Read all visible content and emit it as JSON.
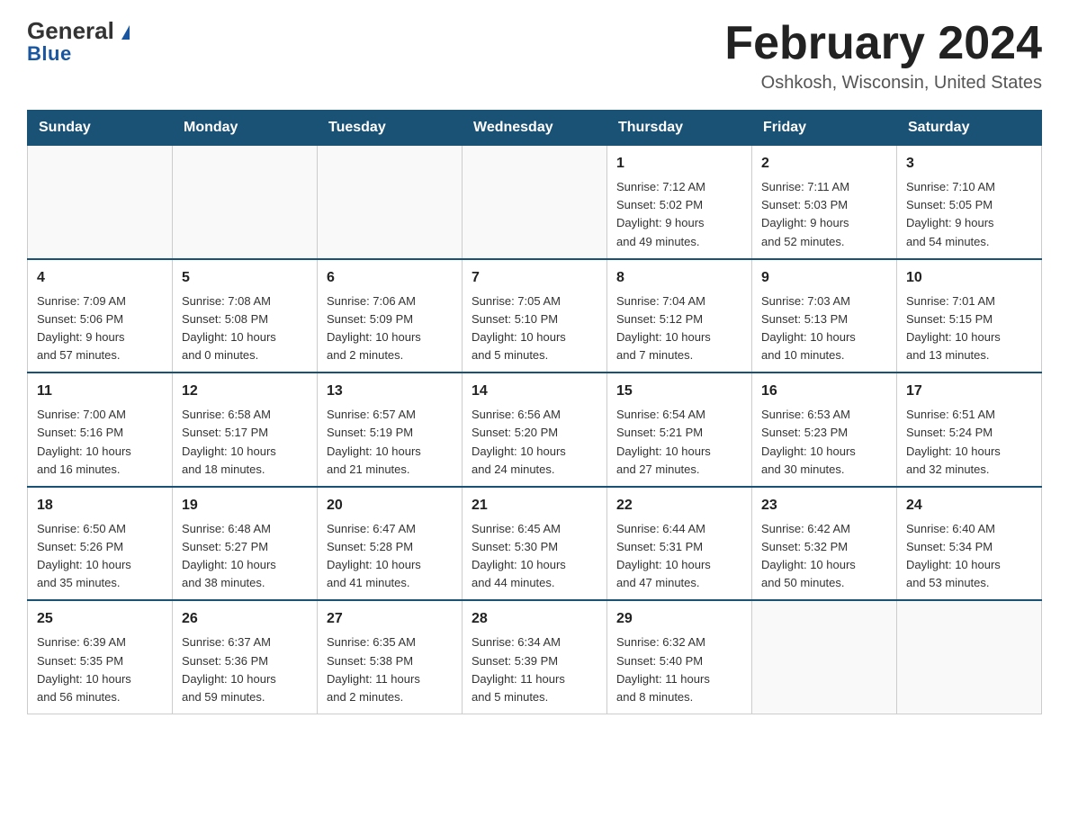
{
  "logo": {
    "top": "General",
    "triangle_text": "▶",
    "bottom": "Blue"
  },
  "calendar": {
    "title": "February 2024",
    "subtitle": "Oshkosh, Wisconsin, United States",
    "headers": [
      "Sunday",
      "Monday",
      "Tuesday",
      "Wednesday",
      "Thursday",
      "Friday",
      "Saturday"
    ],
    "weeks": [
      [
        {
          "day": "",
          "info": ""
        },
        {
          "day": "",
          "info": ""
        },
        {
          "day": "",
          "info": ""
        },
        {
          "day": "",
          "info": ""
        },
        {
          "day": "1",
          "info": "Sunrise: 7:12 AM\nSunset: 5:02 PM\nDaylight: 9 hours\nand 49 minutes."
        },
        {
          "day": "2",
          "info": "Sunrise: 7:11 AM\nSunset: 5:03 PM\nDaylight: 9 hours\nand 52 minutes."
        },
        {
          "day": "3",
          "info": "Sunrise: 7:10 AM\nSunset: 5:05 PM\nDaylight: 9 hours\nand 54 minutes."
        }
      ],
      [
        {
          "day": "4",
          "info": "Sunrise: 7:09 AM\nSunset: 5:06 PM\nDaylight: 9 hours\nand 57 minutes."
        },
        {
          "day": "5",
          "info": "Sunrise: 7:08 AM\nSunset: 5:08 PM\nDaylight: 10 hours\nand 0 minutes."
        },
        {
          "day": "6",
          "info": "Sunrise: 7:06 AM\nSunset: 5:09 PM\nDaylight: 10 hours\nand 2 minutes."
        },
        {
          "day": "7",
          "info": "Sunrise: 7:05 AM\nSunset: 5:10 PM\nDaylight: 10 hours\nand 5 minutes."
        },
        {
          "day": "8",
          "info": "Sunrise: 7:04 AM\nSunset: 5:12 PM\nDaylight: 10 hours\nand 7 minutes."
        },
        {
          "day": "9",
          "info": "Sunrise: 7:03 AM\nSunset: 5:13 PM\nDaylight: 10 hours\nand 10 minutes."
        },
        {
          "day": "10",
          "info": "Sunrise: 7:01 AM\nSunset: 5:15 PM\nDaylight: 10 hours\nand 13 minutes."
        }
      ],
      [
        {
          "day": "11",
          "info": "Sunrise: 7:00 AM\nSunset: 5:16 PM\nDaylight: 10 hours\nand 16 minutes."
        },
        {
          "day": "12",
          "info": "Sunrise: 6:58 AM\nSunset: 5:17 PM\nDaylight: 10 hours\nand 18 minutes."
        },
        {
          "day": "13",
          "info": "Sunrise: 6:57 AM\nSunset: 5:19 PM\nDaylight: 10 hours\nand 21 minutes."
        },
        {
          "day": "14",
          "info": "Sunrise: 6:56 AM\nSunset: 5:20 PM\nDaylight: 10 hours\nand 24 minutes."
        },
        {
          "day": "15",
          "info": "Sunrise: 6:54 AM\nSunset: 5:21 PM\nDaylight: 10 hours\nand 27 minutes."
        },
        {
          "day": "16",
          "info": "Sunrise: 6:53 AM\nSunset: 5:23 PM\nDaylight: 10 hours\nand 30 minutes."
        },
        {
          "day": "17",
          "info": "Sunrise: 6:51 AM\nSunset: 5:24 PM\nDaylight: 10 hours\nand 32 minutes."
        }
      ],
      [
        {
          "day": "18",
          "info": "Sunrise: 6:50 AM\nSunset: 5:26 PM\nDaylight: 10 hours\nand 35 minutes."
        },
        {
          "day": "19",
          "info": "Sunrise: 6:48 AM\nSunset: 5:27 PM\nDaylight: 10 hours\nand 38 minutes."
        },
        {
          "day": "20",
          "info": "Sunrise: 6:47 AM\nSunset: 5:28 PM\nDaylight: 10 hours\nand 41 minutes."
        },
        {
          "day": "21",
          "info": "Sunrise: 6:45 AM\nSunset: 5:30 PM\nDaylight: 10 hours\nand 44 minutes."
        },
        {
          "day": "22",
          "info": "Sunrise: 6:44 AM\nSunset: 5:31 PM\nDaylight: 10 hours\nand 47 minutes."
        },
        {
          "day": "23",
          "info": "Sunrise: 6:42 AM\nSunset: 5:32 PM\nDaylight: 10 hours\nand 50 minutes."
        },
        {
          "day": "24",
          "info": "Sunrise: 6:40 AM\nSunset: 5:34 PM\nDaylight: 10 hours\nand 53 minutes."
        }
      ],
      [
        {
          "day": "25",
          "info": "Sunrise: 6:39 AM\nSunset: 5:35 PM\nDaylight: 10 hours\nand 56 minutes."
        },
        {
          "day": "26",
          "info": "Sunrise: 6:37 AM\nSunset: 5:36 PM\nDaylight: 10 hours\nand 59 minutes."
        },
        {
          "day": "27",
          "info": "Sunrise: 6:35 AM\nSunset: 5:38 PM\nDaylight: 11 hours\nand 2 minutes."
        },
        {
          "day": "28",
          "info": "Sunrise: 6:34 AM\nSunset: 5:39 PM\nDaylight: 11 hours\nand 5 minutes."
        },
        {
          "day": "29",
          "info": "Sunrise: 6:32 AM\nSunset: 5:40 PM\nDaylight: 11 hours\nand 8 minutes."
        },
        {
          "day": "",
          "info": ""
        },
        {
          "day": "",
          "info": ""
        }
      ]
    ]
  }
}
